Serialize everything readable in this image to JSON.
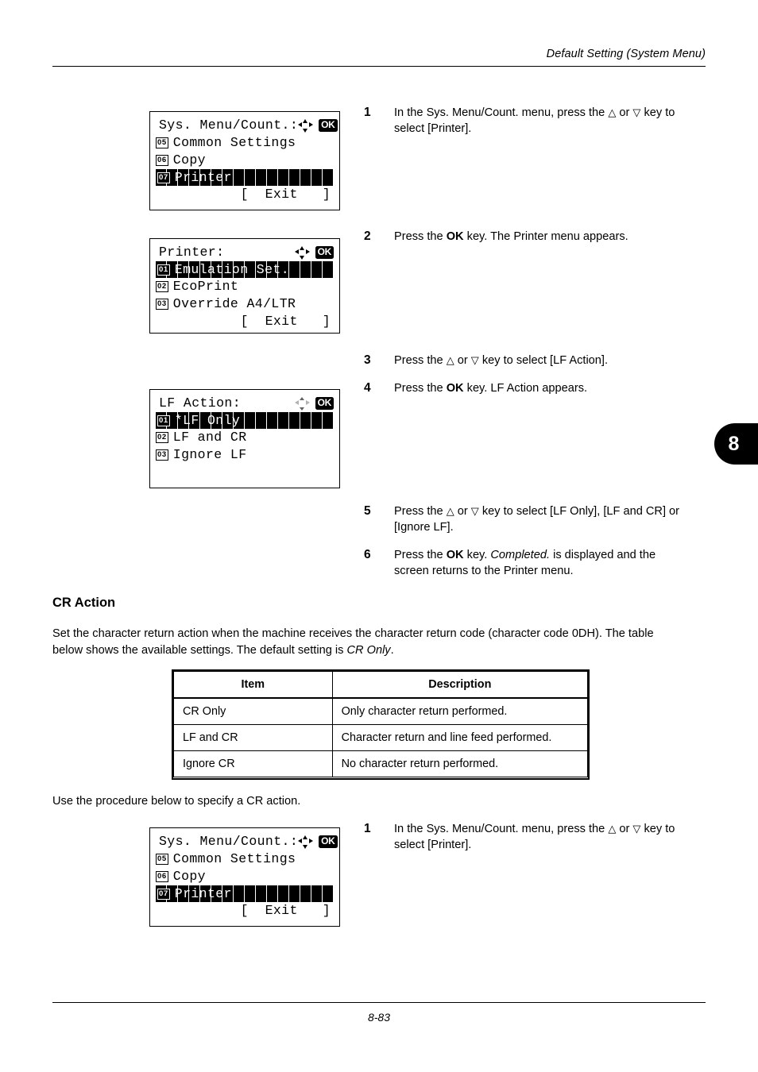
{
  "header": {
    "title": "Default Setting (System Menu)"
  },
  "footer": {
    "page": "8-83"
  },
  "chapter_tab": {
    "number": "8"
  },
  "panels": {
    "sys_menu_top": {
      "title": "Sys. Menu/Count.:",
      "nav_icon": "four-way-arrow-icon",
      "ok_key": "OK",
      "rows": [
        {
          "index": "05",
          "label": "Common Settings",
          "selected": false
        },
        {
          "index": "06",
          "label": "Copy",
          "selected": false
        },
        {
          "index": "07",
          "label": "Printer",
          "selected": true
        }
      ],
      "softkey": "[  Exit   ]"
    },
    "printer": {
      "title": "Printer:",
      "nav_icon": "four-way-arrow-icon",
      "ok_key": "OK",
      "rows": [
        {
          "index": "01",
          "label": "Emulation Set.",
          "selected": true
        },
        {
          "index": "02",
          "label": "EcoPrint",
          "selected": false
        },
        {
          "index": "03",
          "label": "Override A4/LTR",
          "selected": false
        }
      ],
      "softkey": "[  Exit   ]"
    },
    "lf_action": {
      "title": "LF Action:",
      "nav_icon": "up-down-arrow-icon",
      "ok_key": "OK",
      "rows": [
        {
          "index": "01",
          "label": "*LF Only",
          "selected": true
        },
        {
          "index": "02",
          "label": "LF and CR",
          "selected": false
        },
        {
          "index": "03",
          "label": "Ignore LF",
          "selected": false
        }
      ],
      "softkey": ""
    },
    "sys_menu_bottom": {
      "title": "Sys. Menu/Count.:",
      "nav_icon": "four-way-arrow-icon",
      "ok_key": "OK",
      "rows": [
        {
          "index": "05",
          "label": "Common Settings",
          "selected": false
        },
        {
          "index": "06",
          "label": "Copy",
          "selected": false
        },
        {
          "index": "07",
          "label": "Printer",
          "selected": true
        }
      ],
      "softkey": "[  Exit   ]"
    }
  },
  "steps_lf": [
    {
      "num": "1",
      "line1_pre": "In the Sys. Menu/Count. menu, press the ",
      "tri_up": "△",
      "mid": " or ",
      "tri_dn": "▽",
      "line1_post": " key to",
      "line2": "select [Printer]."
    },
    {
      "num": "2",
      "pre": "Press the ",
      "bold": "OK",
      "post": " key. The Printer menu appears."
    },
    {
      "num": "3",
      "pre": "Press the ",
      "tri_up": "△",
      "mid": " or ",
      "tri_dn": "▽",
      "post": " key to select [LF Action]."
    },
    {
      "num": "4",
      "pre": "Press the ",
      "bold": "OK",
      "post": " key. LF Action appears."
    },
    {
      "num": "5",
      "pre": "Press the ",
      "tri_up": "△",
      "mid": " or ",
      "tri_dn": "▽",
      "post": " key to select [LF Only], [LF and CR] or",
      "line2": "[Ignore LF]."
    },
    {
      "num": "6",
      "pre": "Press the ",
      "bold": "OK",
      "mid2": " key. ",
      "italic": "Completed.",
      "post": " is displayed and the",
      "line2": "screen returns to the Printer menu."
    }
  ],
  "cr_section": {
    "heading": "CR Action",
    "paragraph_line1": "Set the character return action when the machine receives the character return code (character code 0DH). The table",
    "paragraph_line2_pre": "below shows the available settings. The default setting is ",
    "paragraph_line2_italic": "CR Only",
    "paragraph_line2_post": ".",
    "procedure_note": "Use the procedure below to specify a CR action.",
    "table": {
      "headers": [
        "Item",
        "Description"
      ],
      "rows": [
        [
          "CR Only",
          "Only character return performed."
        ],
        [
          "LF and CR",
          "Character return and line feed performed."
        ],
        [
          "Ignore CR",
          "No character return performed."
        ]
      ]
    }
  },
  "steps_cr": [
    {
      "num": "1",
      "line1_pre": "In the Sys. Menu/Count. menu, press the ",
      "tri_up": "△",
      "mid": " or ",
      "tri_dn": "▽",
      "line1_post": " key to",
      "line2": "select [Printer]."
    }
  ]
}
